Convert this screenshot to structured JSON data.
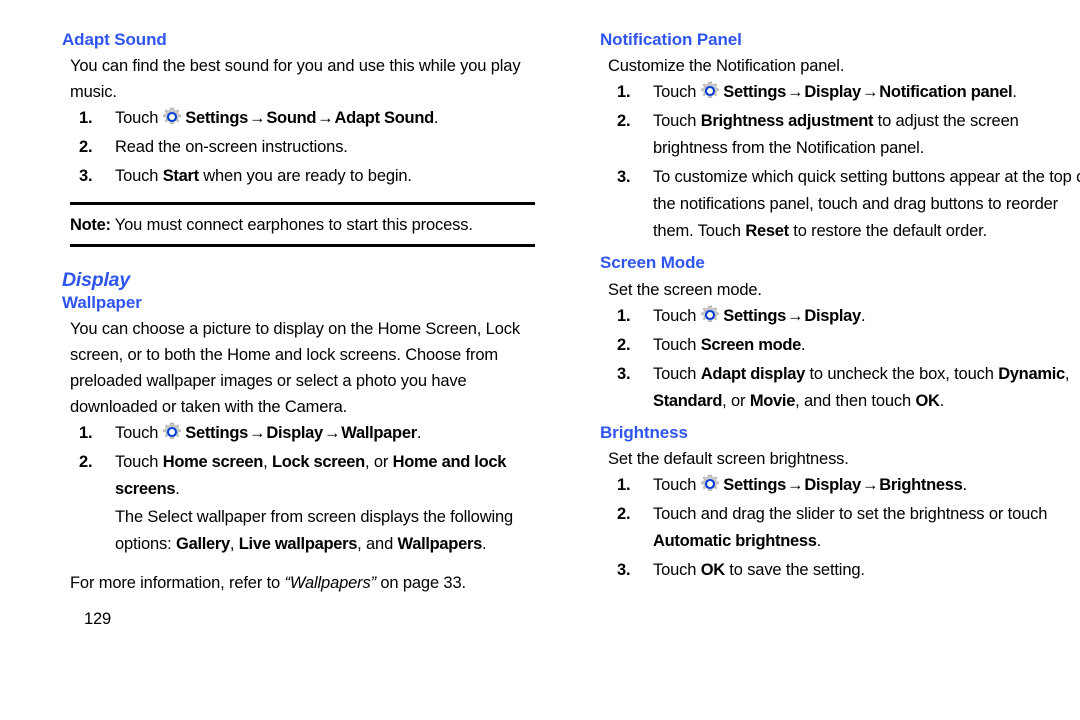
{
  "page": {
    "page_number": "129",
    "heading_color": "#2f55ee",
    "body_color": "#000000",
    "background_color": "#ffffff"
  },
  "icons": {
    "settings_gear": "gear-icon"
  },
  "symbols": {
    "arrow": "→"
  },
  "left_column": {
    "adapt_sound": {
      "heading": "Adapt Sound",
      "intro": "You can find the best sound for you and use this while you play music.",
      "steps": [
        {
          "number": "1.",
          "pre_icon": "Touch",
          "has_icon": true,
          "path": [
            "Settings",
            "Sound",
            "Adapt Sound"
          ],
          "trailing": "."
        },
        {
          "number": "2.",
          "text": "Read the on-screen instructions."
        },
        {
          "number": "3.",
          "text_before": "Touch ",
          "bold": "Start",
          "text_after": " when you are ready to begin."
        }
      ],
      "note": {
        "label": "Note:",
        "text": " You must connect earphones to start this process."
      }
    },
    "display": {
      "heading": "Display",
      "wallpaper": {
        "heading": "Wallpaper",
        "intro": "You can choose a picture to display on the Home Screen, Lock screen, or to both the Home and lock screens. Choose from preloaded wallpaper images or select a photo you have downloaded or taken with the Camera.",
        "steps": [
          {
            "number": "1.",
            "pre_icon": "Touch",
            "has_icon": true,
            "path": [
              "Settings",
              "Display",
              "Wallpaper"
            ],
            "trailing": "."
          },
          {
            "number": "2.",
            "frag": [
              {
                "t": "Touch ",
                "b": false
              },
              {
                "t": "Home screen",
                "b": true
              },
              {
                "t": ", ",
                "b": false
              },
              {
                "t": "Lock screen",
                "b": true
              },
              {
                "t": ", or ",
                "b": false
              },
              {
                "t": "Home and lock screens",
                "b": true
              },
              {
                "t": ".",
                "b": false
              }
            ],
            "sub_frag": [
              {
                "t": "The Select wallpaper from screen displays the following options: ",
                "b": false
              },
              {
                "t": "Gallery",
                "b": true
              },
              {
                "t": ", ",
                "b": false
              },
              {
                "t": "Live wallpapers",
                "b": true
              },
              {
                "t": ", and ",
                "b": false
              },
              {
                "t": "Wallpapers",
                "b": true
              },
              {
                "t": ".",
                "b": false
              }
            ]
          }
        ],
        "reference": {
          "before": "For more information, refer to ",
          "italic": "“Wallpapers”",
          "after": " on page 33."
        }
      }
    }
  },
  "right_column": {
    "notification_panel": {
      "heading": "Notification Panel",
      "intro": "Customize the Notification panel.",
      "steps": [
        {
          "number": "1.",
          "pre_icon": "Touch",
          "has_icon": true,
          "path": [
            "Settings",
            "Display",
            "Notification panel"
          ],
          "trailing": "."
        },
        {
          "number": "2.",
          "frag": [
            {
              "t": "Touch ",
              "b": false
            },
            {
              "t": "Brightness adjustment",
              "b": true
            },
            {
              "t": " to adjust the screen brightness from the Notification panel.",
              "b": false
            }
          ]
        },
        {
          "number": "3.",
          "frag": [
            {
              "t": "To customize which quick setting buttons appear at the top of the notifications panel, touch and drag buttons to reorder them. Touch ",
              "b": false
            },
            {
              "t": "Reset",
              "b": true
            },
            {
              "t": " to restore the default order.",
              "b": false
            }
          ]
        }
      ]
    },
    "screen_mode": {
      "heading": "Screen Mode",
      "intro": "Set the screen mode.",
      "steps": [
        {
          "number": "1.",
          "pre_icon": "Touch",
          "has_icon": true,
          "path": [
            "Settings",
            "Display"
          ],
          "trailing": "."
        },
        {
          "number": "2.",
          "frag": [
            {
              "t": "Touch ",
              "b": false
            },
            {
              "t": "Screen mode",
              "b": true
            },
            {
              "t": ".",
              "b": false
            }
          ]
        },
        {
          "number": "3.",
          "frag": [
            {
              "t": "Touch ",
              "b": false
            },
            {
              "t": "Adapt display",
              "b": true
            },
            {
              "t": " to uncheck the box, touch ",
              "b": false
            },
            {
              "t": "Dynamic",
              "b": true
            },
            {
              "t": ", ",
              "b": false
            },
            {
              "t": "Standard",
              "b": true
            },
            {
              "t": ", or ",
              "b": false
            },
            {
              "t": "Movie",
              "b": true
            },
            {
              "t": ", and then touch ",
              "b": false
            },
            {
              "t": "OK",
              "b": true
            },
            {
              "t": ".",
              "b": false
            }
          ]
        }
      ]
    },
    "brightness": {
      "heading": "Brightness",
      "intro": "Set the default screen brightness.",
      "steps": [
        {
          "number": "1.",
          "pre_icon": "Touch",
          "has_icon": true,
          "path": [
            "Settings",
            "Display",
            "Brightness"
          ],
          "trailing": "."
        },
        {
          "number": "2.",
          "frag": [
            {
              "t": "Touch and drag the slider to set the brightness or touch ",
              "b": false
            },
            {
              "t": "Automatic brightness",
              "b": true
            },
            {
              "t": ".",
              "b": false
            }
          ]
        },
        {
          "number": "3.",
          "frag": [
            {
              "t": "Touch ",
              "b": false
            },
            {
              "t": "OK",
              "b": true
            },
            {
              "t": " to save the setting.",
              "b": false
            }
          ]
        }
      ]
    }
  }
}
